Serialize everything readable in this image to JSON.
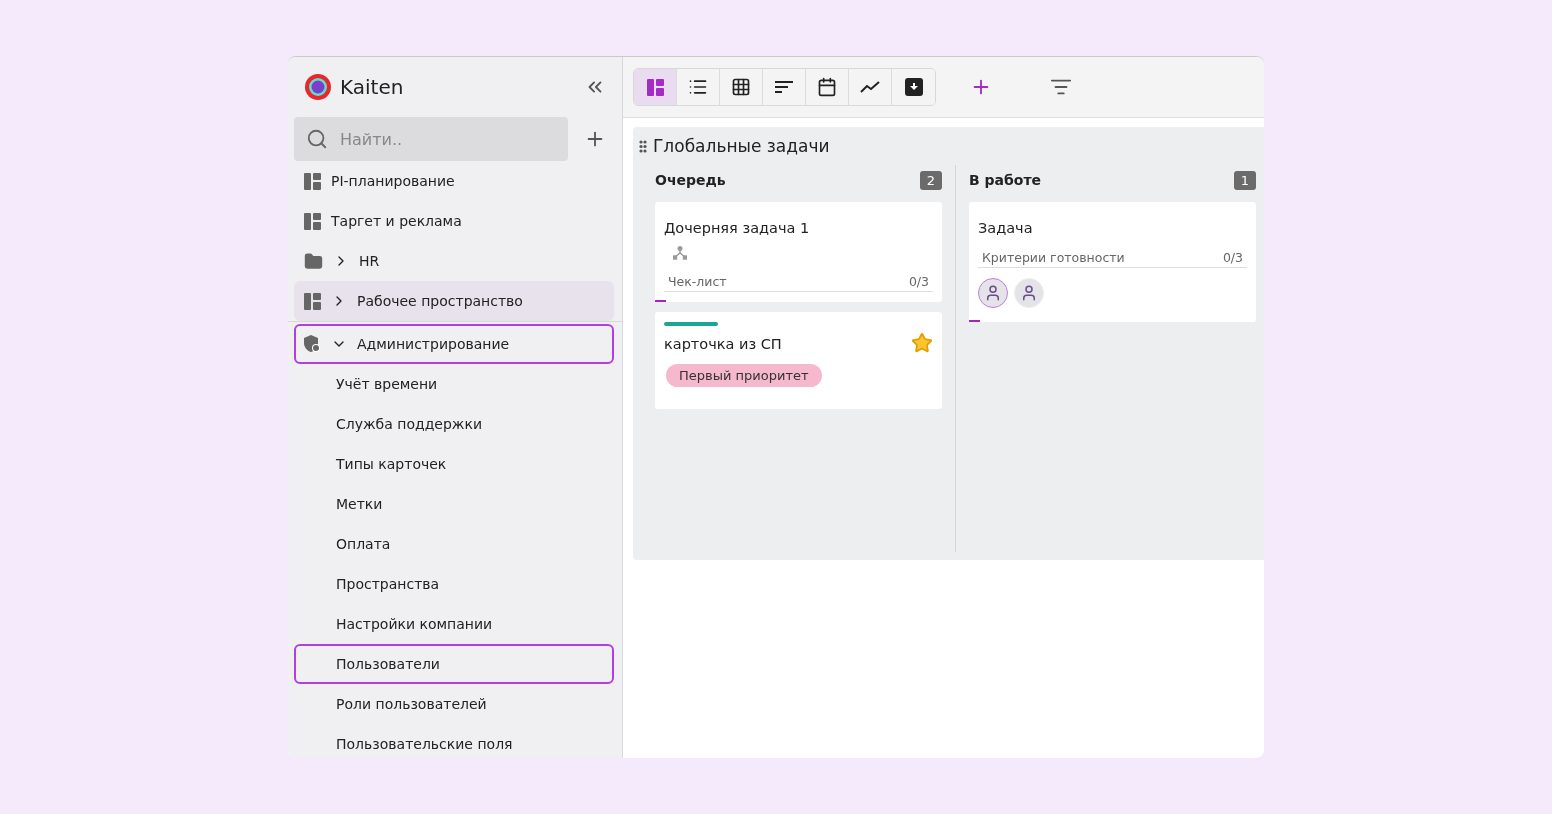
{
  "sidebar": {
    "logo_text": "Kaiten",
    "search": {
      "placeholder": "Найти.."
    },
    "spaces": [
      {
        "kind": "board",
        "label": "PI-планирование",
        "selected": false
      },
      {
        "kind": "board",
        "label": "Таргет и реклама",
        "selected": false
      },
      {
        "kind": "folder",
        "label": "HR",
        "selected": false,
        "expanded": false
      },
      {
        "kind": "board",
        "label": "Рабочее пространство",
        "selected": true,
        "expanded": false
      }
    ],
    "admin": {
      "label": "Администрирование",
      "expanded": true,
      "highlighted": true,
      "children": [
        {
          "label": "Учёт времени",
          "highlighted": false
        },
        {
          "label": "Служба поддержки",
          "highlighted": false
        },
        {
          "label": "Типы карточек",
          "highlighted": false
        },
        {
          "label": "Метки",
          "highlighted": false
        },
        {
          "label": "Оплата",
          "highlighted": false
        },
        {
          "label": "Пространства",
          "highlighted": false
        },
        {
          "label": "Настройки компании",
          "highlighted": false
        },
        {
          "label": "Пользователи",
          "highlighted": true
        },
        {
          "label": "Роли пользователей",
          "highlighted": false
        },
        {
          "label": "Пользовательские поля",
          "highlighted": false
        }
      ]
    }
  },
  "toolbar": {
    "views": [
      {
        "kind": "board",
        "selected": true
      },
      {
        "kind": "list",
        "selected": false
      },
      {
        "kind": "table",
        "selected": false
      },
      {
        "kind": "timeline",
        "selected": false
      },
      {
        "kind": "calendar",
        "selected": false
      },
      {
        "kind": "chart",
        "selected": false
      },
      {
        "kind": "archive",
        "selected": false
      }
    ]
  },
  "board": {
    "title": "Глобальные задачи",
    "columns": [
      {
        "title": "Очередь",
        "count": "2",
        "cards": [
          {
            "title": "Дочерняя задача 1",
            "subtask": true,
            "checklist": {
              "label": "Чек-лист",
              "progress": "0/3",
              "level": 0
            }
          },
          {
            "title": "карточка из СП",
            "color": "#1aa597",
            "starred": true,
            "tag": {
              "label": "Первый приоритет",
              "color": "#f6b8cd"
            }
          }
        ]
      },
      {
        "title": "В работе",
        "count": "1",
        "cards": [
          {
            "title": "Задача",
            "checklist": {
              "label": "Критерии готовности",
              "progress": "0/3",
              "level": 0
            },
            "assignees": [
              {
                "kind": "photo"
              },
              {
                "kind": "illustration"
              }
            ]
          }
        ]
      }
    ]
  }
}
